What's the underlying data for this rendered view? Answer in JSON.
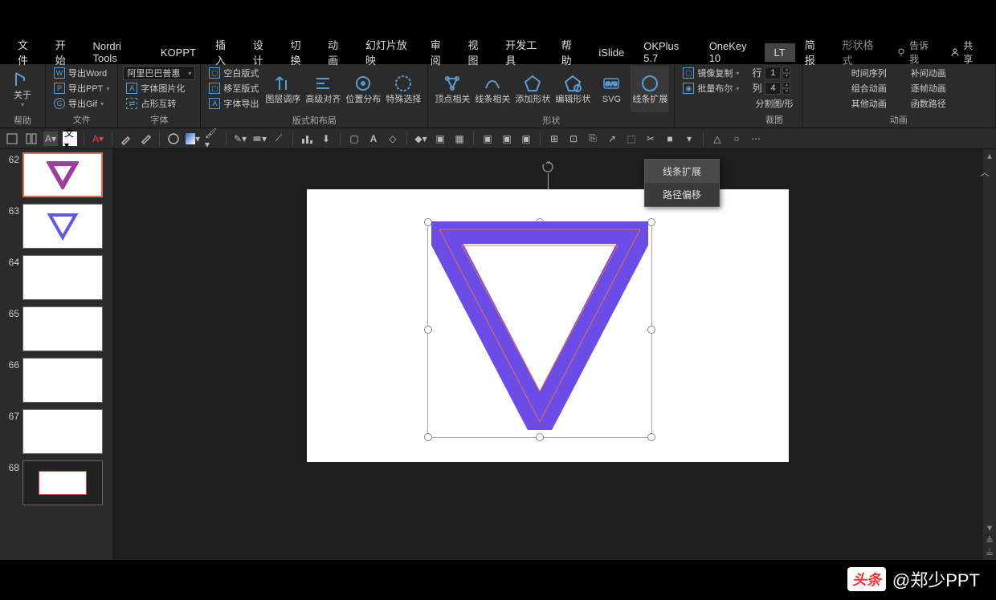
{
  "menubar": {
    "items": [
      "文件",
      "开始",
      "Nordri Tools",
      "KOPPT",
      "插入",
      "设计",
      "切换",
      "动画",
      "幻灯片放映",
      "审阅",
      "视图",
      "开发工具",
      "帮助",
      "iSlide",
      "OKPlus 5.7",
      "OneKey 10",
      "LT",
      "简报",
      "形状格式"
    ],
    "active": "LT",
    "tell": "告诉我",
    "share": "共享"
  },
  "ribbon": {
    "help": {
      "label": "帮助",
      "btn": "关于"
    },
    "file": {
      "label": "文件",
      "items": [
        "导出Word",
        "导出PPT",
        "导出Gif"
      ],
      "prefix": [
        "W",
        "P",
        "G"
      ]
    },
    "font": {
      "label": "字体",
      "select": "阿里巴巴普惠",
      "items": [
        "字体图片化",
        "占形互转",
        "字体导出"
      ],
      "prefix": "A"
    },
    "layout": {
      "label": "版式和布局",
      "items": [
        "空白版式",
        "移至版式"
      ],
      "vbtn": [
        "图层调序",
        "高级对齐",
        "位置分布",
        "特殊选择"
      ]
    },
    "shape": {
      "label": "形状",
      "vbtn": [
        "顶点相关",
        "线条相关",
        "添加形状",
        "编辑形状",
        "SVG",
        "线条扩展"
      ]
    },
    "tools": {
      "items": [
        "镜像复制",
        "批量布尔"
      ]
    },
    "crop": {
      "label": "裁图",
      "row": "行",
      "col": "列",
      "rowval": "1",
      "colval": "4",
      "split": "分割图/形"
    },
    "anim": {
      "label": "动画",
      "items": [
        "时间序列",
        "组合动画",
        "其他动画",
        "补间动画",
        "逐帧动画",
        "函数路径"
      ]
    }
  },
  "dropdown": {
    "items": [
      "线条扩展",
      "路径偏移"
    ],
    "hover": 0
  },
  "thumbs": [
    {
      "num": "62",
      "selected": true,
      "content": "triangle-purple"
    },
    {
      "num": "63",
      "selected": false,
      "content": "triangle-blue"
    },
    {
      "num": "64",
      "selected": false,
      "content": "blank"
    },
    {
      "num": "65",
      "selected": false,
      "content": "blank"
    },
    {
      "num": "66",
      "selected": false,
      "content": "blank"
    },
    {
      "num": "67",
      "selected": false,
      "content": "blank"
    },
    {
      "num": "68",
      "selected": false,
      "content": "dark"
    }
  ],
  "watermark": {
    "logo": "头条",
    "text": "@郑少PPT"
  },
  "colors": {
    "accent": "#5b9bd5",
    "triangle": "#6b4ce6",
    "triangleStroke": "#e07050"
  }
}
